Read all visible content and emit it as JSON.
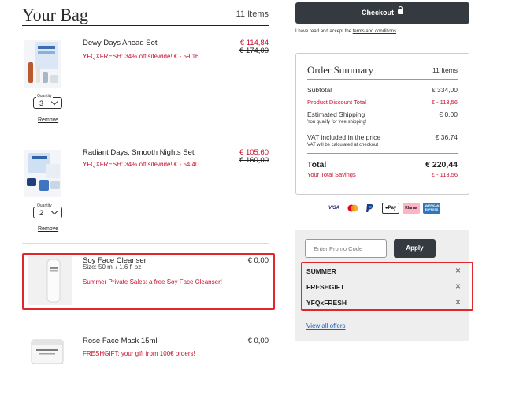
{
  "bag": {
    "title": "Your Bag",
    "count": "11 Items",
    "items": [
      {
        "name": "Dewy Days Ahead Set",
        "promo": "YFQXFRESH: 34% off sitewide! € - 59,16",
        "price": "€ 114,84",
        "old_price": "€ 174,00",
        "quantity_label": "Quantity",
        "quantity": "3",
        "remove_label": "Remove"
      },
      {
        "name": "Radiant Days, Smooth Nights Set",
        "promo": "YFQXFRESH: 34% off sitewide! € - 54,40",
        "price": "€ 105,60",
        "old_price": "€ 160,00",
        "quantity_label": "Quantity",
        "quantity": "2",
        "remove_label": "Remove"
      },
      {
        "name": "Soy Face Cleanser",
        "size": "Size: 50 ml / 1.6 fl oz",
        "promo": "Summer Private Sales: a free Soy Face Cleanser!",
        "price": "€ 0,00"
      },
      {
        "name": "Rose Face Mask 15ml",
        "promo": "FRESHGIFT: your gift from 100€ orders!",
        "price": "€ 0,00"
      }
    ]
  },
  "checkout": {
    "button_label": "Checkout",
    "terms_prefix": "I have read and accept the ",
    "terms_link": "terms and conditions"
  },
  "summary": {
    "title": "Order Summary",
    "count": "11 Items",
    "subtotal_label": "Subtotal",
    "subtotal_value": "€ 334,00",
    "discount_label": "Product Discount Total",
    "discount_value": "€ - 113,56",
    "shipping_label": "Estimated Shipping",
    "shipping_value": "€ 0,00",
    "shipping_note": "You qualify for free shipping!",
    "vat_label": "VAT included in the price",
    "vat_value": "€ 36,74",
    "vat_note": "VAT will be calculated at checkout",
    "total_label": "Total",
    "total_value": "€ 220,44",
    "savings_label": "Your Total Savings",
    "savings_value": "€ - 113,56"
  },
  "payments": {
    "visa": "VISA",
    "applepay": "Pay",
    "klarna": "Klarna",
    "amex": "AMERICAN EXPRESS"
  },
  "offers": {
    "promo_placeholder": "Enter Promo Code",
    "apply_label": "Apply",
    "codes": [
      "SUMMER",
      "FRESHGIFT",
      "YFQxFRESH"
    ],
    "view_all_label": "View all offers"
  },
  "colors": {
    "accent_red": "#c8102e",
    "dark_button": "#343a40",
    "highlight": "#e3262b"
  }
}
